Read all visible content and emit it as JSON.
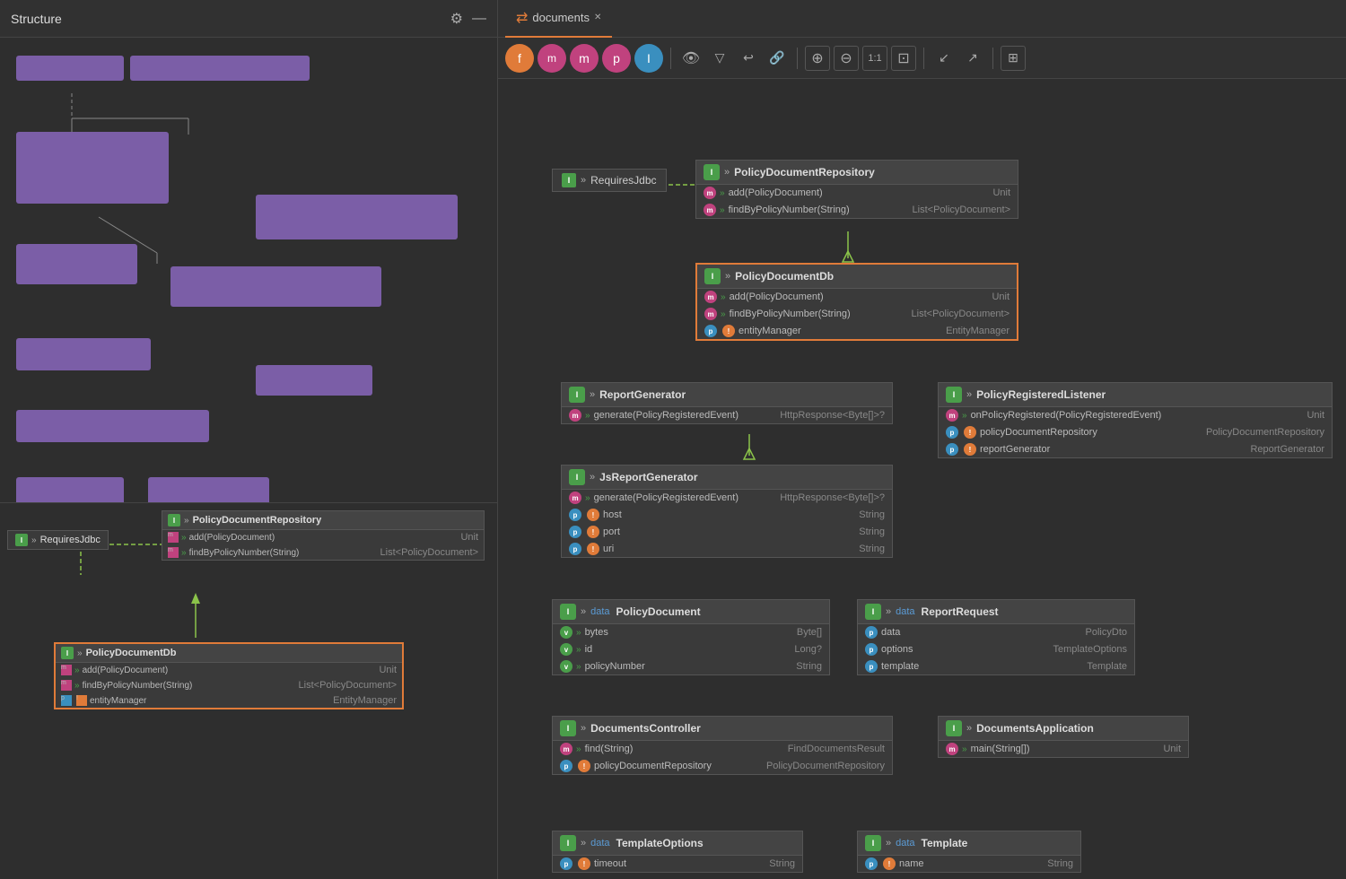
{
  "left_panel": {
    "title": "Structure",
    "icons": [
      "⚙",
      "—"
    ]
  },
  "tab": {
    "icon": "⇄",
    "label": "documents",
    "close": "✕"
  },
  "toolbar": {
    "buttons": [
      {
        "id": "f",
        "label": "f",
        "class": "tool-btn-f"
      },
      {
        "id": "mq",
        "label": "m",
        "class": "tool-btn-mq"
      },
      {
        "id": "m",
        "label": "m",
        "class": "tool-btn-m"
      },
      {
        "id": "p",
        "label": "p",
        "class": "tool-btn-p"
      },
      {
        "id": "i",
        "label": "I",
        "class": "tool-btn-i"
      }
    ],
    "square_buttons": [
      "👁",
      "▽",
      "↩",
      "🔗",
      "⊕",
      "⊖",
      "1:1",
      "⊡",
      "↙",
      "↗",
      "⊞"
    ]
  },
  "diagram": {
    "nodes": {
      "PolicyDocumentRepository": {
        "title": "PolicyDocumentRepository",
        "badge_class": "badge-green",
        "badge_text": "I",
        "rows": [
          {
            "icon_class": "row-icon-pink",
            "icon_text": "m",
            "name": "add(PolicyDocument)",
            "type": "Unit"
          },
          {
            "icon_class": "row-icon-pink",
            "icon_text": "m",
            "name": "findByPolicyNumber(String)",
            "type": "List<PolicyDocument>"
          }
        ]
      },
      "RequiresJdbc_top": {
        "label": "RequiresJdbc",
        "badge_class": "badge-green",
        "badge_text": "I"
      },
      "PolicyDocumentDb": {
        "title": "PolicyDocumentDb",
        "badge_class": "badge-green",
        "badge_text": "I",
        "highlighted": true,
        "rows": [
          {
            "icon_class": "row-icon-pink",
            "icon_text": "m",
            "name": "add(PolicyDocument)",
            "type": "Unit"
          },
          {
            "icon_class": "row-icon-pink",
            "icon_text": "m",
            "name": "findByPolicyNumber(String)",
            "type": "List<PolicyDocument>"
          },
          {
            "icon_class": "row-icon-blue",
            "icon_text": "p",
            "icon2_class": "row-icon-orange",
            "icon2_text": "!",
            "name": "entityManager",
            "type": "EntityManager"
          }
        ]
      },
      "ReportGenerator": {
        "title": "ReportGenerator",
        "badge_class": "badge-green",
        "badge_text": "I",
        "rows": [
          {
            "icon_class": "row-icon-pink",
            "icon_text": "m",
            "name": "generate(PolicyRegisteredEvent)",
            "type": "HttpResponse<Byte[]>?"
          }
        ]
      },
      "JsReportGenerator": {
        "title": "JsReportGenerator",
        "badge_class": "badge-green",
        "badge_text": "I",
        "rows": [
          {
            "icon_class": "row-icon-pink",
            "icon_text": "m",
            "name": "generate(PolicyRegisteredEvent)",
            "type": "HttpResponse<Byte[]>?"
          },
          {
            "icon_class": "row-icon-blue",
            "icon_text": "p",
            "icon2_class": "row-icon-orange",
            "icon2_text": "!",
            "name": "host",
            "type": "String"
          },
          {
            "icon_class": "row-icon-blue",
            "icon_text": "p",
            "icon2_class": "row-icon-orange",
            "icon2_text": "!",
            "name": "port",
            "type": "String"
          },
          {
            "icon_class": "row-icon-blue",
            "icon_text": "p",
            "icon2_class": "row-icon-orange",
            "icon2_text": "!",
            "name": "uri",
            "type": "String"
          }
        ]
      },
      "PolicyRegisteredListener": {
        "title": "PolicyRegisteredListener",
        "badge_class": "badge-green",
        "badge_text": "I",
        "rows": [
          {
            "icon_class": "row-icon-pink",
            "icon_text": "m",
            "name": "onPolicyRegistered(PolicyRegisteredEvent)",
            "type": "Unit"
          },
          {
            "icon_class": "row-icon-blue",
            "icon_text": "p",
            "icon2_class": "row-icon-orange",
            "icon2_text": "!",
            "name": "policyDocumentRepository",
            "type": "PolicyDocumentRepository"
          },
          {
            "icon_class": "row-icon-blue",
            "icon_text": "p",
            "icon2_class": "row-icon-orange",
            "icon2_text": "!",
            "name": "reportGenerator",
            "type": "ReportGenerator"
          }
        ]
      },
      "PolicyDocument": {
        "title": "PolicyDocument",
        "badge_class": "badge-green",
        "badge_text": "I",
        "data_label": "data",
        "rows": [
          {
            "icon_class": "row-icon-green",
            "icon_text": "v",
            "name": "bytes",
            "type": "Byte[]"
          },
          {
            "icon_class": "row-icon-green",
            "icon_text": "v",
            "name": "id",
            "type": "Long?"
          },
          {
            "icon_class": "row-icon-green",
            "icon_text": "v",
            "name": "policyNumber",
            "type": "String"
          }
        ]
      },
      "ReportRequest": {
        "title": "ReportRequest",
        "badge_class": "badge-green",
        "badge_text": "I",
        "data_label": "data",
        "rows": [
          {
            "icon_class": "row-icon-blue",
            "icon_text": "p",
            "name": "data",
            "type": "PolicyDto"
          },
          {
            "icon_class": "row-icon-blue",
            "icon_text": "p",
            "name": "options",
            "type": "TemplateOptions"
          },
          {
            "icon_class": "row-icon-blue",
            "icon_text": "p",
            "name": "template",
            "type": "Template"
          }
        ]
      },
      "DocumentsController": {
        "title": "DocumentsController",
        "badge_class": "badge-green",
        "badge_text": "I",
        "rows": [
          {
            "icon_class": "row-icon-pink",
            "icon_text": "m",
            "name": "find(String)",
            "type": "FindDocumentsResult"
          },
          {
            "icon_class": "row-icon-blue",
            "icon_text": "p",
            "icon2_class": "row-icon-orange",
            "icon2_text": "!",
            "name": "policyDocumentRepository",
            "type": "PolicyDocumentRepository"
          }
        ]
      },
      "DocumentsApplication": {
        "title": "DocumentsApplication",
        "badge_class": "badge-green",
        "badge_text": "I",
        "rows": [
          {
            "icon_class": "row-icon-pink",
            "icon_text": "m",
            "name": "main(String[])",
            "type": "Unit"
          }
        ]
      },
      "TemplateOptions": {
        "title": "TemplateOptions",
        "badge_class": "badge-green",
        "badge_text": "I",
        "data_label": "data",
        "rows": [
          {
            "icon_class": "row-icon-blue",
            "icon_text": "p",
            "icon2_class": "row-icon-orange",
            "icon2_text": "!",
            "name": "timeout",
            "type": "String"
          }
        ]
      },
      "Template": {
        "title": "Template",
        "badge_class": "badge-green",
        "badge_text": "I",
        "data_label": "data",
        "rows": [
          {
            "icon_class": "row-icon-blue",
            "icon_text": "p",
            "icon2_class": "row-icon-orange",
            "icon2_text": "!",
            "name": "name",
            "type": "String"
          }
        ]
      }
    },
    "left_bottom": {
      "RequiresJdbc": {
        "label": "RequiresJdbc"
      },
      "PolicyDocumentRepository": {
        "title": "PolicyDocumentRepository",
        "rows": [
          {
            "name": "add(PolicyDocument)",
            "type": "Unit"
          },
          {
            "name": "findByPolicyNumber(String)",
            "type": "List<PolicyDocument>"
          }
        ]
      },
      "PolicyDocumentDb": {
        "title": "PolicyDocumentDb",
        "highlighted": true,
        "rows": [
          {
            "name": "add(PolicyDocument)",
            "type": "Unit"
          },
          {
            "name": "findByPolicyNumber(String)",
            "type": "List<PolicyDocument>"
          },
          {
            "name": "entityManager",
            "type": "EntityManager"
          }
        ]
      }
    }
  }
}
